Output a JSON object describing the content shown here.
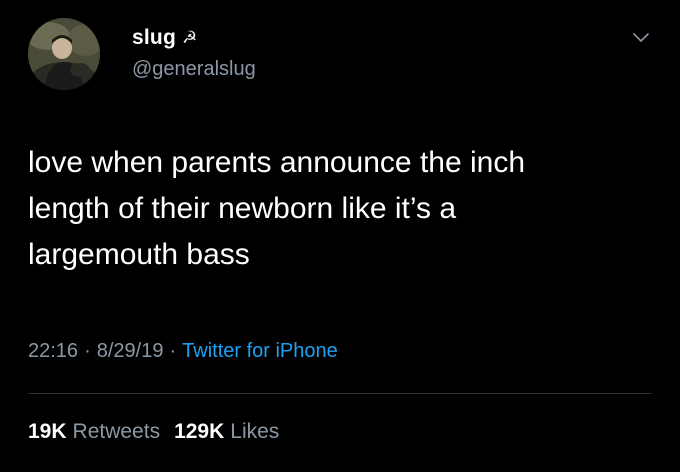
{
  "user": {
    "display_name": "slug",
    "emoji": "☭",
    "handle": "@generalslug"
  },
  "tweet": {
    "text_lines": [
      "love when parents announce the inch",
      "length of their newborn like it’s a",
      "largemouth bass"
    ]
  },
  "meta": {
    "time": "22:16",
    "separator_1": "·",
    "date": "8/29/19",
    "separator_2": "·",
    "source": "Twitter for iPhone"
  },
  "stats": {
    "retweets_count": "19K",
    "retweets_label": "Retweets",
    "likes_count": "129K",
    "likes_label": "Likes"
  },
  "icons": {
    "menu": "chevron-down-icon"
  },
  "colors": {
    "background": "#000000",
    "text": "#ffffff",
    "secondary": "#8b98a5",
    "link": "#1da1f2"
  }
}
